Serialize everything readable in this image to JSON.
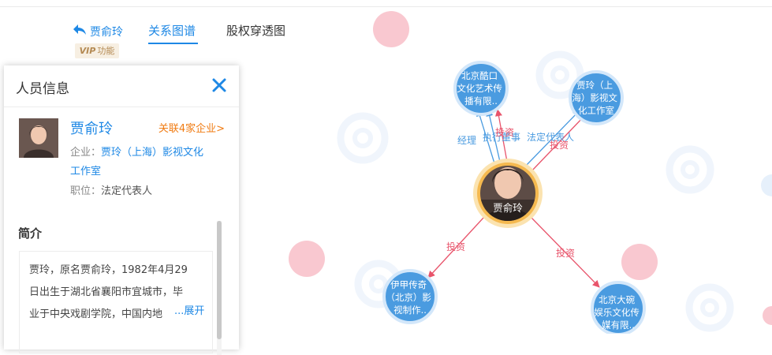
{
  "nav": {
    "back_label": "贾俞玲",
    "tabs": [
      {
        "label": "关系图谱",
        "active": true
      },
      {
        "label": "股权穿透图",
        "active": false
      }
    ],
    "vip_prefix": "VIP",
    "vip_label": "功能"
  },
  "graph": {
    "center": {
      "name": "贾俞玲"
    },
    "nodes": [
      {
        "id": "n1",
        "lines": [
          "北京酷口",
          "文化艺术传",
          "播有限.."
        ]
      },
      {
        "id": "n2",
        "lines": [
          "贾玲（上",
          "海）影视文",
          "化工作室"
        ]
      },
      {
        "id": "n3",
        "lines": [
          "伊甲传奇",
          "（北京）影",
          "视制作.."
        ]
      },
      {
        "id": "n4",
        "lines": [
          "北京大碗",
          "娱乐文化传",
          "媒有限.."
        ]
      }
    ],
    "edge_labels": {
      "manager": "经理",
      "director": "执行董事",
      "invest": "投资",
      "legal": "法定代表人"
    },
    "colors": {
      "invest": "#e8546b",
      "role": "#4a9be0",
      "node": "#4a9be0",
      "center_ring": "#f5b94f",
      "ghost": "#f9c0c9"
    }
  },
  "panel": {
    "title": "人员信息",
    "name": "贾俞玲",
    "related": "关联4家企业>",
    "company_label": "企业：",
    "company_value_1": "贾玲（上海）影视文化",
    "company_value_2": "工作室",
    "position_label": "职位：",
    "position_value": "法定代表人",
    "bio_title": "简介",
    "bio_lines": [
      "贾玲，原名贾俞玲，1982年4月29",
      "日出生于湖北省襄阳市宜城市，毕",
      "业于中央戏剧学院，中国内地"
    ],
    "expand": "...展开"
  }
}
